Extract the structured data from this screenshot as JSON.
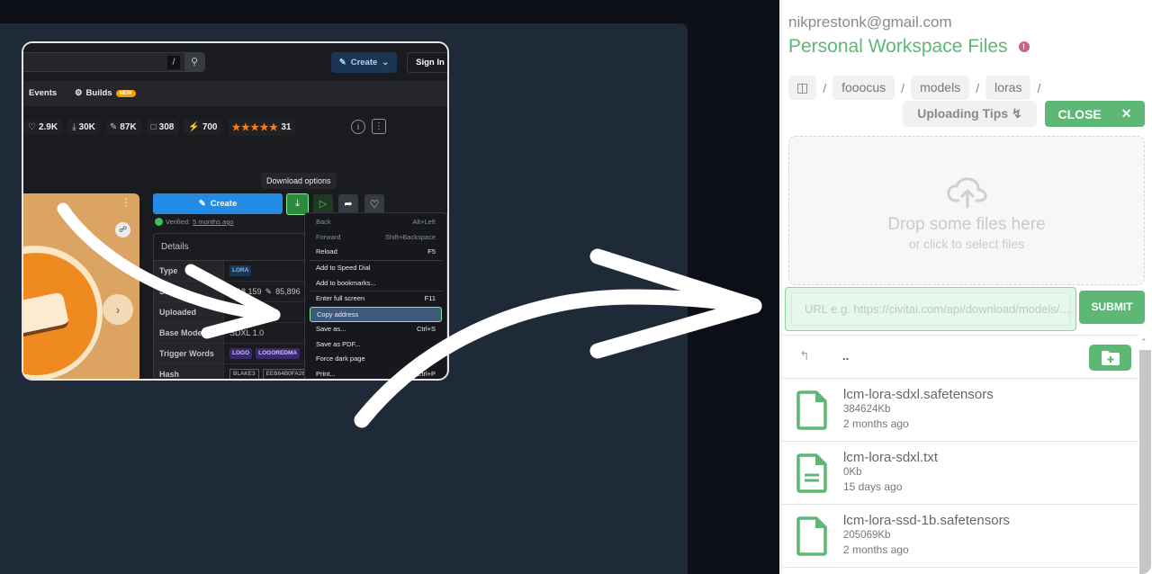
{
  "embedded_screenshot": {
    "search": {
      "shortcut": "/",
      "icon": "search-icon"
    },
    "create_top_label": "Create",
    "signin_label": "Sign In",
    "nav": [
      {
        "label": "Events"
      },
      {
        "label": "Builds",
        "badge": "NEW"
      }
    ],
    "stats": {
      "likes": "2.9K",
      "downloads": "30K",
      "generations": "87K",
      "bookmarks": "308",
      "buzz": "700",
      "rating_count": "31",
      "rating_stars": 5
    },
    "tooltip": "Download options",
    "create_main_label": "Create",
    "verified_prefix": "Verified:",
    "verified_when": "5 months ago",
    "details": {
      "title": "Details",
      "rows": [
        {
          "key": "Type",
          "value": "LORA"
        },
        {
          "key": "Stats",
          "downloads": "18,159",
          "generations": "85,896"
        },
        {
          "key": "Uploaded",
          "value": ""
        },
        {
          "key": "Base Model",
          "value": "SDXL 1.0"
        },
        {
          "key": "Trigger Words",
          "tags": [
            "LOGO",
            "LOGOREDMA"
          ]
        },
        {
          "key": "Hash",
          "algo": "BLAKE3",
          "value": "EEB64B0FA26"
        }
      ]
    },
    "context_menu": [
      {
        "label": "Back",
        "shortcut": "Alt+Left",
        "disabled": true
      },
      {
        "label": "Forward",
        "shortcut": "Shift+Backspace",
        "disabled": true
      },
      {
        "label": "Reload",
        "shortcut": "F5"
      },
      {
        "separator": true
      },
      {
        "label": "Add to Speed Dial",
        "shortcut": ""
      },
      {
        "label": "Add to bookmarks...",
        "shortcut": ""
      },
      {
        "separator": true
      },
      {
        "label": "Enter full screen",
        "shortcut": "F11"
      },
      {
        "label": "Copy address",
        "shortcut": "",
        "selected": true
      },
      {
        "label": "Save as...",
        "shortcut": "Ctrl+S"
      },
      {
        "label": "Save as PDF...",
        "shortcut": ""
      },
      {
        "label": "Force dark page",
        "shortcut": ""
      },
      {
        "label": "Print...",
        "shortcut": "Ctrl+P"
      }
    ]
  },
  "panel": {
    "email": "nikprestonk@gmail.com",
    "title": "Personal Workspace Files",
    "info_icon": "info-icon",
    "breadcrumb": [
      "fooocus",
      "models",
      "loras"
    ],
    "uploading_tips_label": "Uploading Tips",
    "close_label": "CLOSE",
    "dropzone": {
      "main": "Drop some files here",
      "sub": "or click to select files"
    },
    "url_placeholder": "URL e.g. https://civitai.com/api/download/models/...",
    "submit_label": "SUBMIT",
    "parent_label": "..",
    "files": [
      {
        "name": "lcm-lora-sdxl.safetensors",
        "size": "384624Kb",
        "modified": "2 months ago",
        "type": "file"
      },
      {
        "name": "lcm-lora-sdxl.txt",
        "size": "0Kb",
        "modified": "15 days ago",
        "type": "text"
      },
      {
        "name": "lcm-lora-ssd-1b.safetensors",
        "size": "205069Kb",
        "modified": "2 months ago",
        "type": "file"
      }
    ]
  },
  "colors": {
    "accent_green": "#5cb874",
    "info_pink": "#c7657e",
    "stage_bg": "#1f2a38",
    "page_bg": "#0c0f18"
  }
}
